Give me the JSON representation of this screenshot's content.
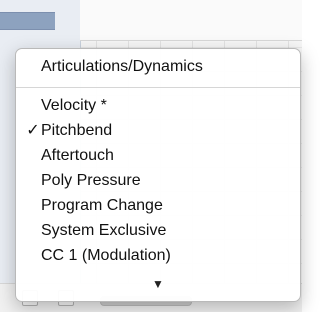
{
  "menu": {
    "header": "Articulations/Dynamics",
    "items": [
      {
        "label": "Velocity *",
        "checked": false
      },
      {
        "label": "Pitchbend",
        "checked": true
      },
      {
        "label": "Aftertouch",
        "checked": false
      },
      {
        "label": "Poly Pressure",
        "checked": false
      },
      {
        "label": "Program Change",
        "checked": false
      },
      {
        "label": "System Exclusive",
        "checked": false
      },
      {
        "label": "CC 1  (Modulation)",
        "checked": false
      }
    ],
    "checkmark": "✓",
    "scroll_indicator": "▼"
  }
}
